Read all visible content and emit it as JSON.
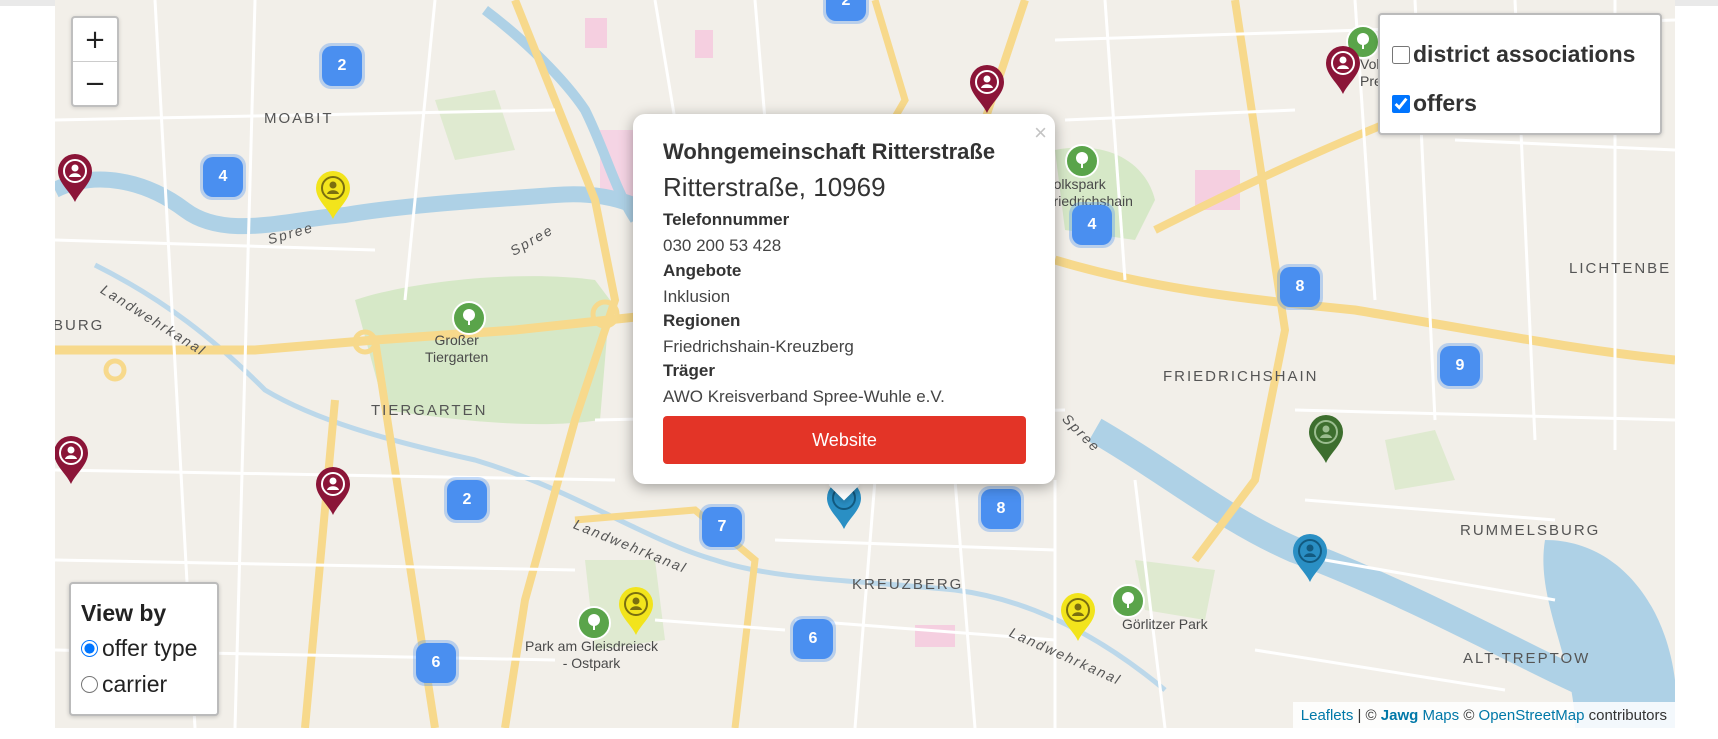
{
  "zoom": {
    "in_label": "+",
    "out_label": "−"
  },
  "layers": [
    {
      "label": "district associations",
      "checked": false
    },
    {
      "label": "offers",
      "checked": true
    }
  ],
  "viewby": {
    "title": "View by",
    "options": [
      {
        "label": "offer type",
        "checked": true
      },
      {
        "label": "carrier",
        "checked": false
      }
    ]
  },
  "popup": {
    "close": "×",
    "title": "Wohngemeinschaft Ritterstraße",
    "address": "Ritterstraße, 10969",
    "fields": [
      {
        "label": "Telefonnummer",
        "value": "030 200 53 428"
      },
      {
        "label": "Angebote",
        "value": "Inklusion"
      },
      {
        "label": "Regionen",
        "value": "Friedrichshain-Kreuzberg"
      },
      {
        "label": "Träger",
        "value": "AWO Kreisverband Spree-Wuhle e.V."
      }
    ],
    "button": "Website"
  },
  "clusters": [
    "2",
    "2",
    "4",
    "4",
    "8",
    "9",
    "2",
    "7",
    "8",
    "6",
    "6"
  ],
  "district_labels": [
    "MOABIT",
    "TIERGARTEN",
    "FRIEDRICHSHAIN",
    "KREUZBERG",
    "LICHTENBE",
    "RUMMELSBURG",
    "ALT-TREPTOW",
    "BURG"
  ],
  "park_labels": [
    "Großer Tiergarten",
    "Volkspark Friedrichshain",
    "Görlitzer Park",
    "Park am Gleisdreieck - Ostpark",
    "Volkspark Prenzlauer"
  ],
  "park_label_text": {
    "grosser": [
      "Großer",
      "Tiergarten"
    ],
    "volkspark": [
      "Volkspark",
      "Friedrichshain"
    ],
    "goerlitzer": "Görlitzer Park",
    "gleisdreieck": [
      "Park am Gleisdreieck",
      "- Ostpark"
    ],
    "prenzlauer": [
      "Volkspa",
      "Prenzlauer"
    ]
  },
  "water_labels": [
    "Spree",
    "Spree",
    "Spree",
    "Landwehrkanal",
    "Landwehrkanal",
    "Landwehrkanal"
  ],
  "marker_colors": {
    "burgundy": "#8b1538",
    "yellow": "#f2e41c",
    "green": "#3d6e2e",
    "blue": "#2a8fc4"
  },
  "attribution": {
    "leaflet": "Leaflets",
    "sep": " | © ",
    "jawg": "Jawg",
    "maps": " Maps",
    "copy": " © ",
    "osm": "OpenStreetMap",
    "contrib": " contributors"
  }
}
